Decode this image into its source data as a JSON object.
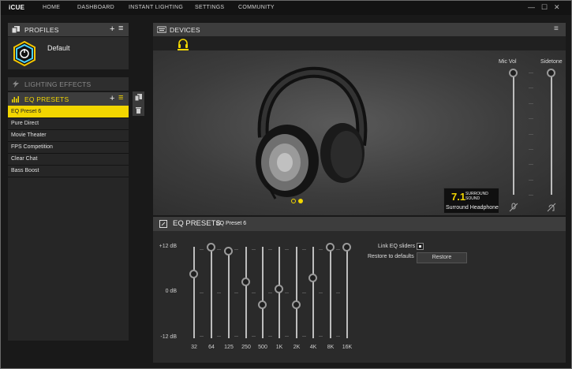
{
  "app": {
    "logo": "iCUE"
  },
  "nav": [
    "HOME",
    "DASHBOARD",
    "INSTANT LIGHTING",
    "SETTINGS",
    "COMMUNITY"
  ],
  "window_controls": {
    "minimize": "—",
    "maximize": "☐",
    "close": "✕"
  },
  "profiles": {
    "header": "PROFILES",
    "add": "+",
    "menu": "≡",
    "active_name": "Default"
  },
  "lighting": {
    "header": "LIGHTING EFFECTS"
  },
  "eq_presets_panel": {
    "header": "EQ PRESETS",
    "add": "+",
    "menu": "≡",
    "items": [
      "EQ Preset 6",
      "Pure Direct",
      "Movie Theater",
      "FPS Competition",
      "Clear Chat",
      "Bass Boost"
    ],
    "selected_index": 0
  },
  "devices": {
    "header": "DEVICES",
    "menu": "≡"
  },
  "mic": {
    "mic_vol_label": "Mic Vol",
    "sidetone_label": "Sidetone",
    "mic_vol_level": 1.0,
    "sidetone_level": 1.0
  },
  "badge": {
    "big": "7.1",
    "top": "SURROUND",
    "bottom": "SOUND",
    "caption": "Surround Headphone"
  },
  "eq": {
    "header": "EQ PRESETS",
    "preset_name": "EQ Preset 6",
    "db_top": "+12 dB",
    "db_mid": "0 dB",
    "db_bottom": "-12 dB",
    "link_label": "Link EQ sliders",
    "restore_label": "Restore to defaults",
    "restore_button": "Restore",
    "bands": [
      "32",
      "64",
      "125",
      "250",
      "500",
      "1K",
      "2K",
      "4K",
      "8K",
      "16K"
    ],
    "gains_db": [
      5,
      12,
      11,
      3,
      -3,
      1,
      -3,
      4,
      12,
      12
    ]
  },
  "colors": {
    "accent": "#f2d600",
    "panel_header": "#3d3d3d",
    "background": "#191919"
  }
}
